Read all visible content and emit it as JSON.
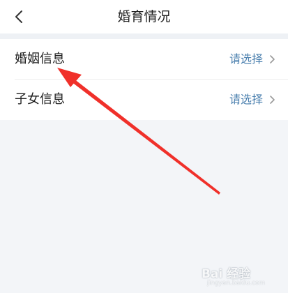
{
  "header": {
    "title": "婚育情况",
    "back_icon": "chevron-left-icon"
  },
  "rows": [
    {
      "label": "婚姻信息",
      "value": "请选择",
      "icon": "chevron-right-icon"
    },
    {
      "label": "子女信息",
      "value": "请选择",
      "icon": "chevron-right-icon"
    }
  ],
  "watermark": {
    "text": "Bai 经验",
    "subtext": "jingyan.baidu.com"
  },
  "colors": {
    "background": "#f3f5f8",
    "value_text": "#4a7fae",
    "annotation_arrow": "#f0302a"
  }
}
